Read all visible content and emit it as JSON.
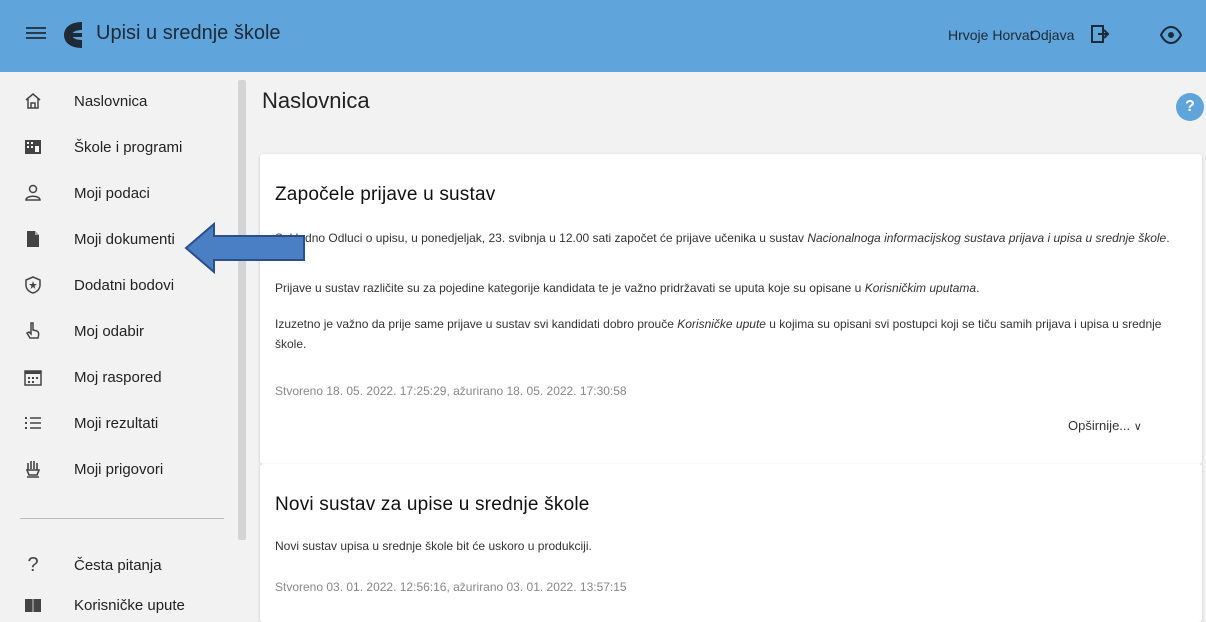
{
  "app": {
    "title": "Upisi u srednje škole"
  },
  "header": {
    "user_name": "Hrvoje Horvat",
    "logout_label": "Odjava"
  },
  "sidebar": {
    "items": [
      {
        "label": "Naslovnica",
        "icon": "home-icon"
      },
      {
        "label": "Škole i programi",
        "icon": "building-icon"
      },
      {
        "label": "Moji podaci",
        "icon": "person-icon"
      },
      {
        "label": "Moji dokumenti",
        "icon": "document-icon"
      },
      {
        "label": "Dodatni bodovi",
        "icon": "star-shield-icon"
      },
      {
        "label": "Moj odabir",
        "icon": "hand-pointer-icon"
      },
      {
        "label": "Moj raspored",
        "icon": "calendar-icon"
      },
      {
        "label": "Moji rezultati",
        "icon": "list-icon"
      },
      {
        "label": "Moji prigovori",
        "icon": "raised-hand-icon"
      }
    ],
    "bottom_items": [
      {
        "label": "Česta pitanja",
        "icon": "question-icon"
      },
      {
        "label": "Korisničke upute",
        "icon": "book-icon"
      }
    ]
  },
  "main": {
    "page_title": "Naslovnica",
    "help_label": "?",
    "cards": [
      {
        "title": "Započele prijave u sustav",
        "p1_a": "Sukladno Odluci o upisu, u ponedjeljak, 23. svibnja u 12.00 sati započet će prijave učenika u sustav ",
        "p1_em": "Nacionalnoga informacijskog sustava prijava i upisa u srednje škole",
        "p1_b": ".",
        "p2_a": "Prijave u sustav različite su za pojedine kategorije kandidata te je važno pridržavati se uputa koje su opisane u ",
        "p2_em": "Korisničkim uputama",
        "p2_b": ".",
        "p3_a": "Izuzetno je važno da prije same prijave u sustav svi kandidati dobro prouče ",
        "p3_em": "Korisničke upute",
        "p3_b": " u kojima su opisani svi postupci koji se tiču samih prijava i upisa u srednje škole.",
        "stamp": "Stvoreno 18. 05. 2022. 17:25:29, ažurirano 18. 05. 2022. 17:30:58",
        "more_label": "Opširnije..."
      },
      {
        "title": "Novi sustav za upise u srednje škole",
        "p1": "Novi sustav upisa u srednje škole bit će uskoro u produkciji.",
        "stamp": "Stvoreno 03. 01. 2022. 12:56:16, ažurirano 03. 01. 2022. 13:57:15"
      }
    ]
  },
  "colors": {
    "header_bg": "#5fa5dc",
    "arrow_fill": "#4a7fc4",
    "arrow_stroke": "#2b4f8a"
  }
}
